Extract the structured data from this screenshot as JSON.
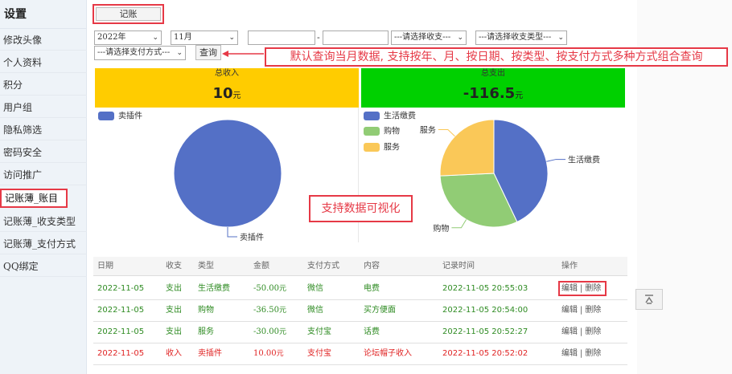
{
  "sidebar": {
    "title": "设置",
    "items": [
      {
        "label": "修改头像"
      },
      {
        "label": "个人资料"
      },
      {
        "label": "积分"
      },
      {
        "label": "用户组"
      },
      {
        "label": "隐私筛选"
      },
      {
        "label": "密码安全"
      },
      {
        "label": "访问推广"
      },
      {
        "label": "记账薄_账目"
      },
      {
        "label": "记账薄_收支类型"
      },
      {
        "label": "记账薄_支付方式"
      },
      {
        "label": "QQ绑定"
      }
    ]
  },
  "toolbar": {
    "record_label": "记账",
    "year": "2022年",
    "month": "11月",
    "separator": "-",
    "income_expense_select": "---请选择收支---",
    "category_select": "---请选择收支类型---",
    "payment_select": "---请选择支付方式---",
    "query_label": "查询"
  },
  "annotations": {
    "query_tip": "默认查询当月数据, 支持按年、月、按日期、按类型、按支付方式多种方式组合查询",
    "viz_tip": "支持数据可视化"
  },
  "summary": {
    "income_label": "总收入",
    "income_value": "10",
    "income_unit": "元",
    "expense_label": "总支出",
    "expense_value": "-116.5",
    "expense_unit": "元"
  },
  "colors": {
    "income_header": "#ffcc00",
    "expense_header": "#00d000",
    "blue": "#5470c6",
    "green": "#91cc75",
    "yellow": "#fac858",
    "accent_red": "#e63946"
  },
  "chart_data": [
    {
      "type": "pie",
      "title": "",
      "legend": [
        "卖插件"
      ],
      "slices": [
        {
          "name": "卖插件",
          "value": 10,
          "color": "#5470c6"
        }
      ]
    },
    {
      "type": "pie",
      "title": "",
      "legend": [
        "生活缴费",
        "购物",
        "服务"
      ],
      "slices": [
        {
          "name": "生活缴费",
          "value": 50,
          "color": "#5470c6"
        },
        {
          "name": "购物",
          "value": 36.5,
          "color": "#91cc75"
        },
        {
          "name": "服务",
          "value": 30,
          "color": "#fac858"
        }
      ]
    }
  ],
  "table": {
    "headers": [
      "日期",
      "收支",
      "类型",
      "金额",
      "支付方式",
      "内容",
      "记录时间",
      "操作"
    ],
    "rows": [
      {
        "date": "2022-11-05",
        "io": "支出",
        "type": "生活缴费",
        "amount": "-50.00",
        "unit": "元",
        "pay": "微信",
        "content": "电费",
        "time": "2022-11-05 20:55:03",
        "edit": "编辑",
        "sep": "|",
        "del": "删除",
        "kind": "expense"
      },
      {
        "date": "2022-11-05",
        "io": "支出",
        "type": "购物",
        "amount": "-36.50",
        "unit": "元",
        "pay": "微信",
        "content": "买方便面",
        "time": "2022-11-05 20:54:00",
        "edit": "编辑",
        "sep": "|",
        "del": "删除",
        "kind": "expense"
      },
      {
        "date": "2022-11-05",
        "io": "支出",
        "type": "服务",
        "amount": "-30.00",
        "unit": "元",
        "pay": "支付宝",
        "content": "话费",
        "time": "2022-11-05 20:52:27",
        "edit": "编辑",
        "sep": "|",
        "del": "删除",
        "kind": "expense"
      },
      {
        "date": "2022-11-05",
        "io": "收入",
        "type": "卖插件",
        "amount": "10.00",
        "unit": "元",
        "pay": "支付宝",
        "content": "论坛帽子收入",
        "time": "2022-11-05 20:52:02",
        "edit": "编辑",
        "sep": "|",
        "del": "删除",
        "kind": "income"
      }
    ]
  },
  "scroll_top_icon": "scroll-to-top-icon"
}
